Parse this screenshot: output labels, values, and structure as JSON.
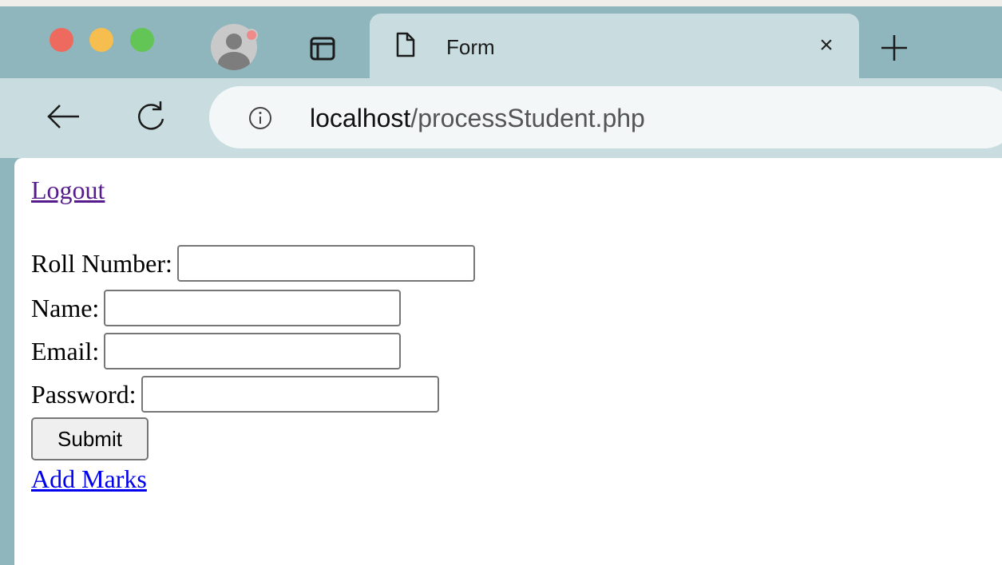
{
  "browser": {
    "tab": {
      "title": "Form",
      "close_label": "×",
      "icon": "document-icon"
    },
    "new_tab_icon": "plus-icon",
    "address": {
      "host": "localhost",
      "path": "/processStudent.php"
    },
    "colors": {
      "tab_bar": "#8fb5bd",
      "active_tab": "#c9dde1",
      "traffic_red": "#ee6a5e",
      "traffic_yellow": "#f5be4f",
      "traffic_green": "#62c555"
    }
  },
  "page": {
    "logout_label": "Logout",
    "form": {
      "roll_label": "Roll Number:",
      "roll_value": "",
      "name_label": "Name:",
      "name_value": "",
      "email_label": "Email:",
      "email_value": "",
      "password_label": "Password:",
      "password_value": "",
      "submit_label": "Submit"
    },
    "add_marks_label": "Add Marks",
    "colors": {
      "visited_link": "#551a8b",
      "link": "#0000ee"
    }
  }
}
